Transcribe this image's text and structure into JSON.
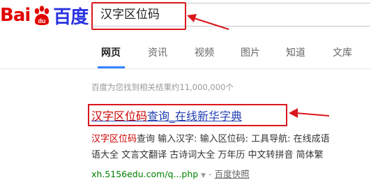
{
  "logo": {
    "text_left": "Bai",
    "paw": "du",
    "text_right": "百度"
  },
  "search": {
    "query": "汉字区位码"
  },
  "tabs": [
    {
      "label": "网页",
      "active": true
    },
    {
      "label": "资讯",
      "active": false
    },
    {
      "label": "视频",
      "active": false
    },
    {
      "label": "图片",
      "active": false
    },
    {
      "label": "知道",
      "active": false
    },
    {
      "label": "文库",
      "active": false
    }
  ],
  "results_count": "百度为您找到相关结果约11,000,000个",
  "result": {
    "title_highlight": "汉字区位码",
    "title_rest": "查询_在线新华字典",
    "snippet1_highlight": "汉字区位码",
    "snippet1_rest": "查询 输入汉字: 输入区位码: 工具导航: 在线成语",
    "snippet2": "语大全 文言文翻译 古诗词大全 万年历 中文转拼音 简体繁",
    "url": "xh.5156edu.com/q...php",
    "url_dropdown": "▼",
    "separator": "-",
    "snapshot": "百度快照"
  },
  "colors": {
    "accent_red": "#d9171c",
    "link_blue": "#2440b3",
    "url_green": "#008000",
    "tab_blue": "#3385ff"
  }
}
